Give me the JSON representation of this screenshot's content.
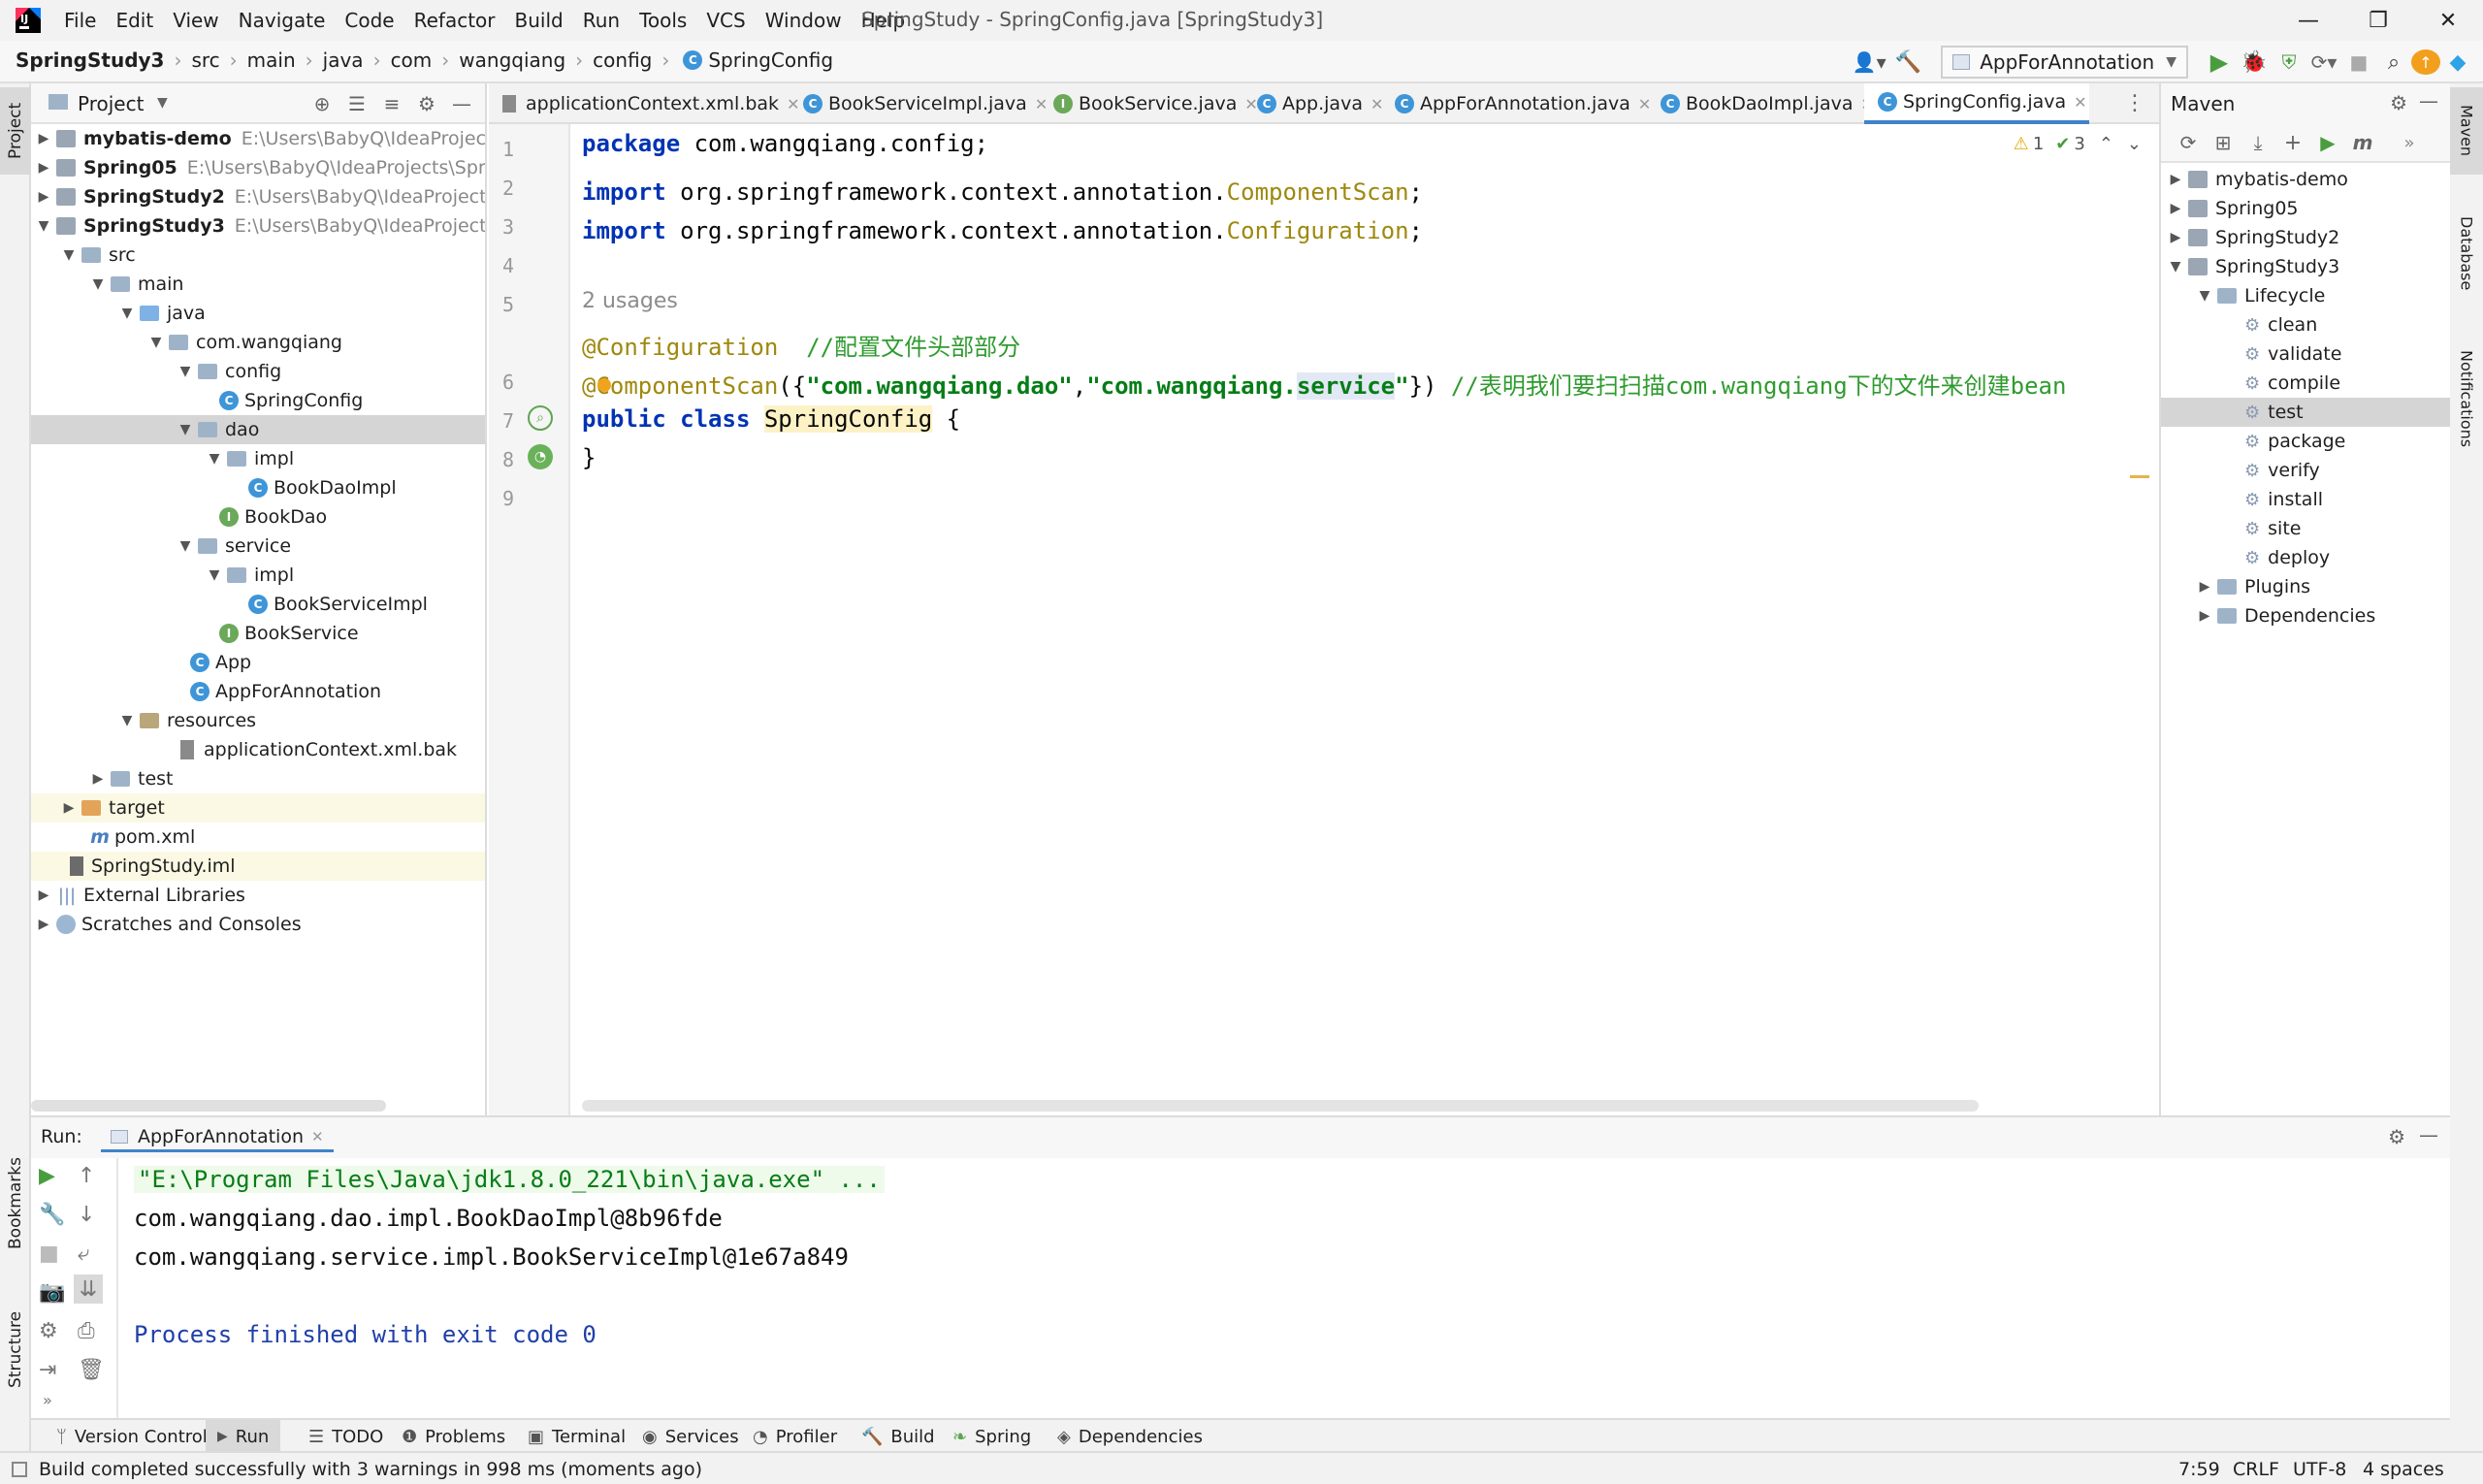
{
  "menu": [
    "File",
    "Edit",
    "View",
    "Navigate",
    "Code",
    "Refactor",
    "Build",
    "Run",
    "Tools",
    "VCS",
    "Window",
    "Help"
  ],
  "window_title": "SpringStudy - SpringConfig.java [SpringStudy3]",
  "breadcrumbs": [
    "SpringStudy3",
    "src",
    "main",
    "java",
    "com",
    "wangqiang",
    "config",
    "SpringConfig"
  ],
  "run_config": "AppForAnnotation",
  "project": {
    "title": "Project",
    "tree": [
      {
        "label": "mybatis-demo",
        "path": "E:\\Users\\BabyQ\\IdeaProjects\\m",
        "bold": true
      },
      {
        "label": "Spring05",
        "path": "E:\\Users\\BabyQ\\IdeaProjects\\SpringS",
        "bold": true
      },
      {
        "label": "SpringStudy2",
        "path": "E:\\Users\\BabyQ\\IdeaProjects\\Spr",
        "bold": true
      },
      {
        "label": "SpringStudy3",
        "path": "E:\\Users\\BabyQ\\IdeaProjects\\Spr",
        "bold": true
      },
      {
        "label": "src"
      },
      {
        "label": "main"
      },
      {
        "label": "java"
      },
      {
        "label": "com.wangqiang"
      },
      {
        "label": "config"
      },
      {
        "label": "SpringConfig"
      },
      {
        "label": "dao"
      },
      {
        "label": "impl"
      },
      {
        "label": "BookDaoImpl"
      },
      {
        "label": "BookDao"
      },
      {
        "label": "service"
      },
      {
        "label": "impl"
      },
      {
        "label": "BookServiceImpl"
      },
      {
        "label": "BookService"
      },
      {
        "label": "App"
      },
      {
        "label": "AppForAnnotation"
      },
      {
        "label": "resources"
      },
      {
        "label": "applicationContext.xml.bak"
      },
      {
        "label": "test"
      },
      {
        "label": "target"
      },
      {
        "label": "pom.xml"
      },
      {
        "label": "SpringStudy.iml"
      },
      {
        "label": "External Libraries"
      },
      {
        "label": "Scratches and Consoles"
      }
    ]
  },
  "tabs": [
    "applicationContext.xml.bak",
    "BookServiceImpl.java",
    "BookService.java",
    "App.java",
    "AppForAnnotation.java",
    "BookDaoImpl.java",
    "SpringConfig.java"
  ],
  "editor": {
    "line_numbers": [
      "1",
      "2",
      "3",
      "4",
      "5",
      "6",
      "7",
      "8",
      "9"
    ],
    "usages": "2 usages",
    "warnings": "1",
    "checks": "3",
    "l1_kw": "package",
    "l1_rest": " com.wangqiang.config;",
    "l3_kw": "import",
    "l3_pkg": " org.springframework.context.annotation.",
    "l3_cls": "ComponentScan",
    "l4_kw": "import",
    "l4_pkg": " org.springframework.context.annotation.",
    "l4_cls": "Configuration",
    "semi": ";",
    "l6_ann": "@Configuration",
    "l6_cmt": "  //配置文件头部部分",
    "l7_ann": "@ComponentScan",
    "l7_open": "({",
    "l7_s1": "\"com.wangqiang.dao\"",
    "l7_comma": ",",
    "l7_s2a": "\"com.wangqiang.",
    "l7_s2b": "service",
    "l7_s2c": "\"",
    "l7_close": "})",
    "l7_cmt": " //表明我们要扫扫描com.wangqiang下的文件来创建bean",
    "l8_kw": "public class",
    "l8_cls": "SpringConfig",
    "l8_rest": " {",
    "l9": "}"
  },
  "maven": {
    "title": "Maven",
    "items": [
      "mybatis-demo",
      "Spring05",
      "SpringStudy2",
      "SpringStudy3",
      "Lifecycle",
      "clean",
      "validate",
      "compile",
      "test",
      "package",
      "verify",
      "install",
      "site",
      "deploy",
      "Plugins",
      "Dependencies"
    ]
  },
  "run": {
    "label": "Run:",
    "tab": "AppForAnnotation",
    "lines": [
      "\"E:\\Program Files\\Java\\jdk1.8.0_221\\bin\\java.exe\" ...",
      "com.wangqiang.dao.impl.BookDaoImpl@8b96fde",
      "com.wangqiang.service.impl.BookServiceImpl@1e67a849",
      "Process finished with exit code 0"
    ]
  },
  "toolwindows": [
    "Version Control",
    "Run",
    "TODO",
    "Problems",
    "Terminal",
    "Services",
    "Profiler",
    "Build",
    "Spring",
    "Dependencies"
  ],
  "side_tabs": {
    "project": "Project",
    "bookmarks": "Bookmarks",
    "structure": "Structure",
    "maven": "Maven",
    "database": "Database",
    "notifications": "Notifications"
  },
  "status": {
    "message": "Build completed successfully with 3 warnings in 998 ms (moments ago)",
    "position": "7:59",
    "line_sep": "CRLF",
    "encoding": "UTF-8",
    "indent": "4 spaces"
  },
  "colors": {
    "keyword": "#0033b3",
    "string": "#067d17",
    "annotation": "#9e880d",
    "comment": "#8c8c8c",
    "selection": "#d5d5d5",
    "accent": "#4083c9"
  }
}
